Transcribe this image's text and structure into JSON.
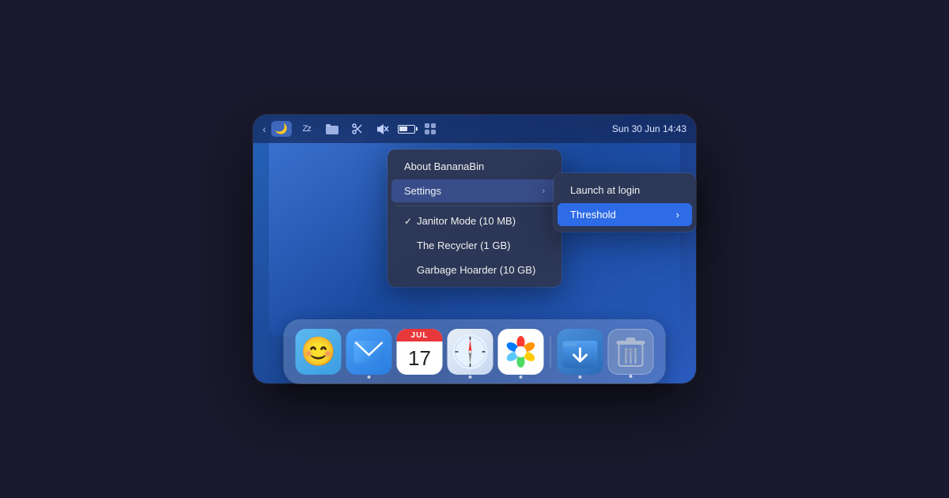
{
  "window": {
    "title": "BananaBin"
  },
  "menubar": {
    "datetime": "Sun 30 Jun  14:43",
    "icons": [
      "‹",
      "🌙",
      "Zz",
      "📁",
      "✂",
      "🔇",
      "🔋",
      "⊞"
    ]
  },
  "main_menu": {
    "items": [
      {
        "id": "about",
        "label": "About BananaBin",
        "check": "",
        "has_arrow": false
      },
      {
        "id": "settings",
        "label": "Settings",
        "check": "",
        "has_arrow": true
      }
    ],
    "separator": true,
    "mode_items": [
      {
        "id": "janitor",
        "label": "Janitor Mode (10 MB)",
        "check": "✓",
        "has_arrow": false
      },
      {
        "id": "recycler",
        "label": "The Recycler (1 GB)",
        "check": "",
        "has_arrow": false
      },
      {
        "id": "hoarder",
        "label": "Garbage Hoarder (10 GB)",
        "check": "",
        "has_arrow": false
      }
    ]
  },
  "settings_submenu": {
    "items": [
      {
        "id": "launch",
        "label": "Launch at login",
        "has_arrow": false
      },
      {
        "id": "threshold",
        "label": "Threshold",
        "has_arrow": true,
        "highlighted": true
      }
    ]
  },
  "dock": {
    "icons": [
      {
        "id": "finder",
        "label": "Finder"
      },
      {
        "id": "mail",
        "label": "Mail"
      },
      {
        "id": "calendar",
        "label": "Calendar",
        "month": "JUL",
        "day": "17"
      },
      {
        "id": "safari",
        "label": "Safari"
      },
      {
        "id": "photos",
        "label": "Photos"
      },
      {
        "id": "downloads",
        "label": "Downloads"
      },
      {
        "id": "trash",
        "label": "Trash"
      }
    ]
  }
}
